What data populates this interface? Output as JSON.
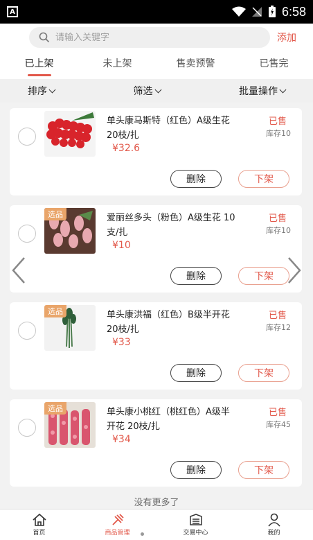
{
  "status_bar": {
    "time": "6:58"
  },
  "search": {
    "placeholder": "请输入关键字",
    "add_label": "添加"
  },
  "tabs": [
    {
      "label": "已上架",
      "active": true
    },
    {
      "label": "未上架",
      "active": false
    },
    {
      "label": "售卖预警",
      "active": false
    },
    {
      "label": "已售完",
      "active": false
    }
  ],
  "filters": {
    "sort": "排序",
    "filter": "筛选",
    "batch": "批量操作"
  },
  "products": [
    {
      "tag": "",
      "title": "单头康马斯特（红色）A级生花 20枝/扎",
      "price": "¥32.6",
      "status": "已售",
      "stock": "库存10",
      "delete_label": "删除",
      "offshelf_label": "下架"
    },
    {
      "tag": "选品",
      "title": "爱丽丝多头（粉色）A级生花 10支/扎",
      "price": "¥10",
      "status": "已售",
      "stock": "库存10",
      "delete_label": "删除",
      "offshelf_label": "下架"
    },
    {
      "tag": "选品",
      "title": "单头康洪福（红色）B级半开花 20枝/扎",
      "price": "¥33",
      "status": "已售",
      "stock": "库存12",
      "delete_label": "删除",
      "offshelf_label": "下架"
    },
    {
      "tag": "选品",
      "title": "单头康小桃红（桃红色）A级半开花 20枝/扎",
      "price": "¥34",
      "status": "已售",
      "stock": "库存45",
      "delete_label": "删除",
      "offshelf_label": "下架"
    }
  ],
  "no_more": "没有更多了",
  "nav": [
    {
      "label": "首页",
      "icon": "home-icon",
      "active": false
    },
    {
      "label": "商品管理",
      "icon": "product-manage-icon",
      "active": true
    },
    {
      "label": "交易中心",
      "icon": "trade-center-icon",
      "active": false
    },
    {
      "label": "我的",
      "icon": "user-icon",
      "active": false
    }
  ],
  "colors": {
    "accent": "#e2584a",
    "tag": "#e9a56a"
  }
}
